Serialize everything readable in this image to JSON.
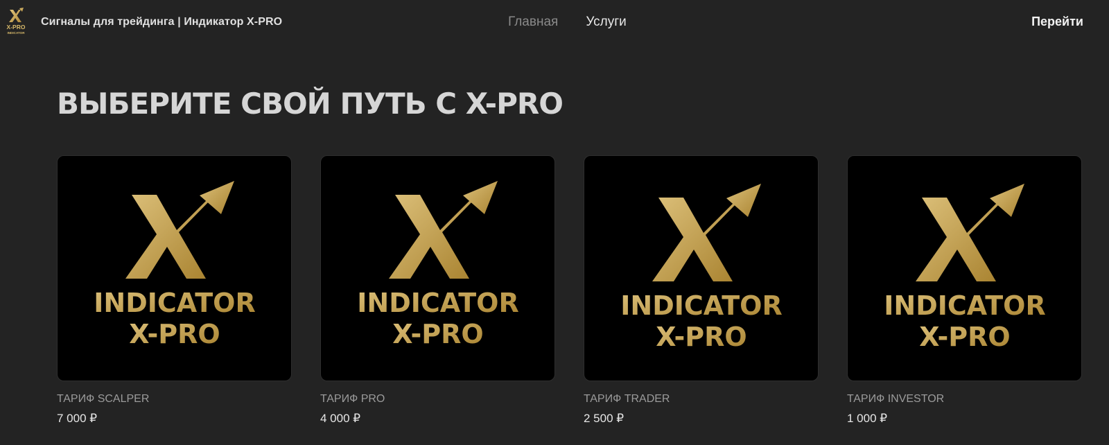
{
  "header": {
    "logo_text": "X-PRO",
    "logo_subtext": "INDICATOR",
    "site_title": "Сигналы для трейдинга | Индикатор X-PRO",
    "nav": [
      {
        "label": "Главная",
        "active": true
      },
      {
        "label": "Услуги",
        "active": false
      }
    ],
    "cta_label": "Перейти"
  },
  "main": {
    "heading": "ВЫБЕРИТЕ СВОЙ ПУТЬ С X-PRO",
    "products": [
      {
        "name": "ТАРИФ SCALPER",
        "price": "7 000 ₽",
        "image_line1": "INDICATOR",
        "image_line2": "X-PRO"
      },
      {
        "name": "ТАРИФ PRO",
        "price": "4 000 ₽",
        "image_line1": "INDICATOR",
        "image_line2": "X-PRO"
      },
      {
        "name": "ТАРИФ TRADER",
        "price": "2 500 ₽",
        "image_line1": "INDICATOR",
        "image_line2": "X-PRO"
      },
      {
        "name": "ТАРИФ INVESTOR",
        "price": "1 000 ₽",
        "image_line1": "INDICATOR",
        "image_line2": "X-PRO"
      }
    ]
  },
  "colors": {
    "background": "#232323",
    "gold": "#c9a75a",
    "muted_text": "#9b9b9b"
  }
}
